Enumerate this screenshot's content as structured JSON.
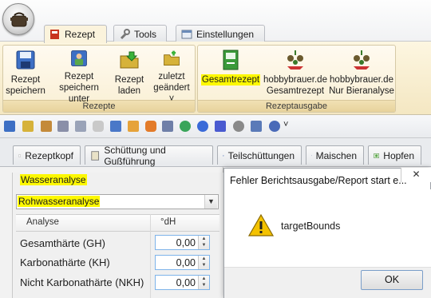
{
  "ribbon": {
    "tabs": [
      {
        "label": "Rezept",
        "icon": "recipe-book-icon"
      },
      {
        "label": "Tools",
        "icon": "wrench-icon"
      },
      {
        "label": "Einstellungen",
        "icon": "settings-icon"
      }
    ],
    "groups": [
      {
        "label": "Rezepte",
        "buttons": [
          {
            "line1": "Rezept",
            "line2": "speichern",
            "icon": "save-disk-icon"
          },
          {
            "line1": "Rezept",
            "line2": "speichern unter",
            "icon": "save-as-user-icon"
          },
          {
            "line1": "Rezept",
            "line2": "laden",
            "icon": "open-folder-icon"
          },
          {
            "line1": "zuletzt",
            "line2": "geändert ˅",
            "icon": "recent-folder-icon"
          }
        ]
      },
      {
        "label": "Rezeptausgabe",
        "buttons": [
          {
            "line1": "Gesamtrezept",
            "line2": "",
            "icon": "green-book-icon"
          },
          {
            "line1": "hobbybrauer.de",
            "line2": "Gesamtrezept",
            "icon": "hobbybrauer-hops-icon"
          },
          {
            "line1": "hobbybrauer.de",
            "line2": "Nur Bieranalyse",
            "icon": "hobbybrauer-hops-icon"
          }
        ]
      }
    ]
  },
  "quick_toolbar": {
    "dropdown_glyph": "˅"
  },
  "doc_tabs": [
    {
      "label": "Rezeptkopf",
      "icon": "document-icon"
    },
    {
      "label": "Schüttung und Gußführung",
      "icon": "grain-icon"
    },
    {
      "label": "Teilschüttungen",
      "icon": "table-icon"
    },
    {
      "label": "Maischen",
      "icon": "chart-icon"
    },
    {
      "label": "Hopfen",
      "icon": "hops-icon"
    }
  ],
  "panel": {
    "section_label": "Wasseranalyse",
    "combo_value": "Rohwasseranalyse",
    "table": {
      "headers": [
        "Analyse",
        "°dH"
      ],
      "rows": [
        {
          "label": "Gesamthärte (GH)",
          "value": "0,00"
        },
        {
          "label": "Karbonathärte (KH)",
          "value": "0,00"
        },
        {
          "label": "Nicht Karbonathärte (NKH)",
          "value": "0,00"
        }
      ]
    }
  },
  "dialog": {
    "title": "Fehler Berichtsausgabe/Report start e...",
    "close_glyph": "✕",
    "message": "targetBounds",
    "ok_label": "OK"
  },
  "colors": {
    "highlight": "#fdf800",
    "ribbon_bg": "#f9efd3",
    "warning": "#f4c200"
  }
}
